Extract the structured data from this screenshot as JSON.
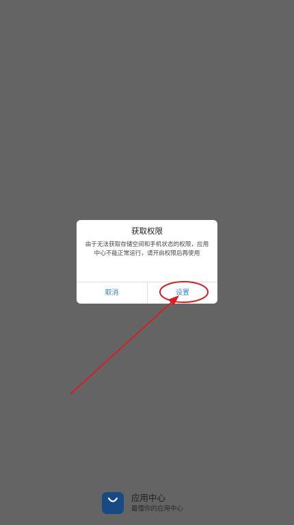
{
  "dialog": {
    "title": "获取权限",
    "message": "由于无法获取存储空间和手机状态的权限，应用中心不能正常运行，请开启权限后再使用",
    "cancel_label": "取消",
    "settings_label": "设置"
  },
  "footer": {
    "app_name": "应用中心",
    "slogan": "最懂你的应用中心"
  },
  "colors": {
    "backdrop": "#646464",
    "dialog_bg": "#ffffff",
    "button_text": "#2f86d6",
    "annotation_red": "#e0191e",
    "logo_bg": "#174a84"
  },
  "icons": {
    "app_logo": "shopping-bag-smile-icon",
    "annotation": "red-arrow-and-circle"
  }
}
